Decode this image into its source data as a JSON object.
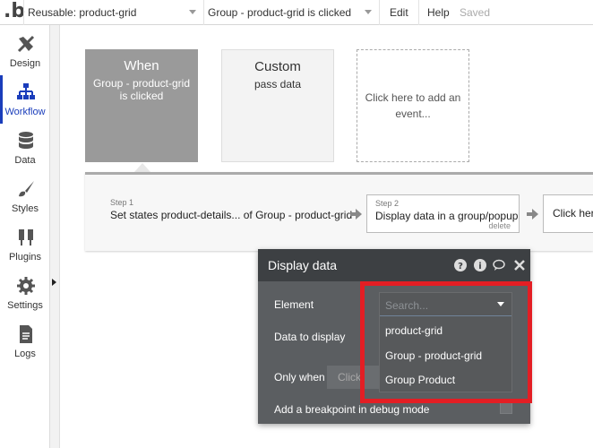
{
  "topbar": {
    "logo": ".b",
    "reusable": "Reusable: product-grid",
    "event": "Group - product-grid is clicked",
    "edit": "Edit",
    "help": "Help",
    "saved": "Saved"
  },
  "sidebar": {
    "items": [
      {
        "label": "Design",
        "icon": "design-icon"
      },
      {
        "label": "Workflow",
        "icon": "workflow-icon",
        "active": true
      },
      {
        "label": "Data",
        "icon": "data-icon"
      },
      {
        "label": "Styles",
        "icon": "styles-icon"
      },
      {
        "label": "Plugins",
        "icon": "plugins-icon"
      },
      {
        "label": "Settings",
        "icon": "settings-icon"
      },
      {
        "label": "Logs",
        "icon": "logs-icon"
      }
    ]
  },
  "events": {
    "when": {
      "title": "When",
      "subtitle": "Group - product-grid is clicked"
    },
    "custom": {
      "title": "Custom",
      "subtitle": "pass data"
    },
    "add": {
      "text": "Click here to add an event..."
    }
  },
  "steps": {
    "step1": {
      "num": "Step 1",
      "text": "Set states product-details... of Group - product-grid"
    },
    "step2": {
      "num": "Step 2",
      "text": "Display data in a group/popup",
      "delete": "delete"
    },
    "step3": {
      "text": "Click here"
    }
  },
  "panel": {
    "title": "Display data",
    "element_label": "Element",
    "data_label": "Data to display",
    "only_when_label": "Only when",
    "only_when_placeholder": "Click",
    "breakpoint_label": "Add a breakpoint in debug mode"
  },
  "dropdown": {
    "placeholder": "Search...",
    "options": [
      "product-grid",
      "Group - product-grid",
      "Group Product"
    ]
  },
  "colors": {
    "accent": "#1a3dbb",
    "highlight": "#e31e24",
    "panel": "#5b5e61"
  }
}
